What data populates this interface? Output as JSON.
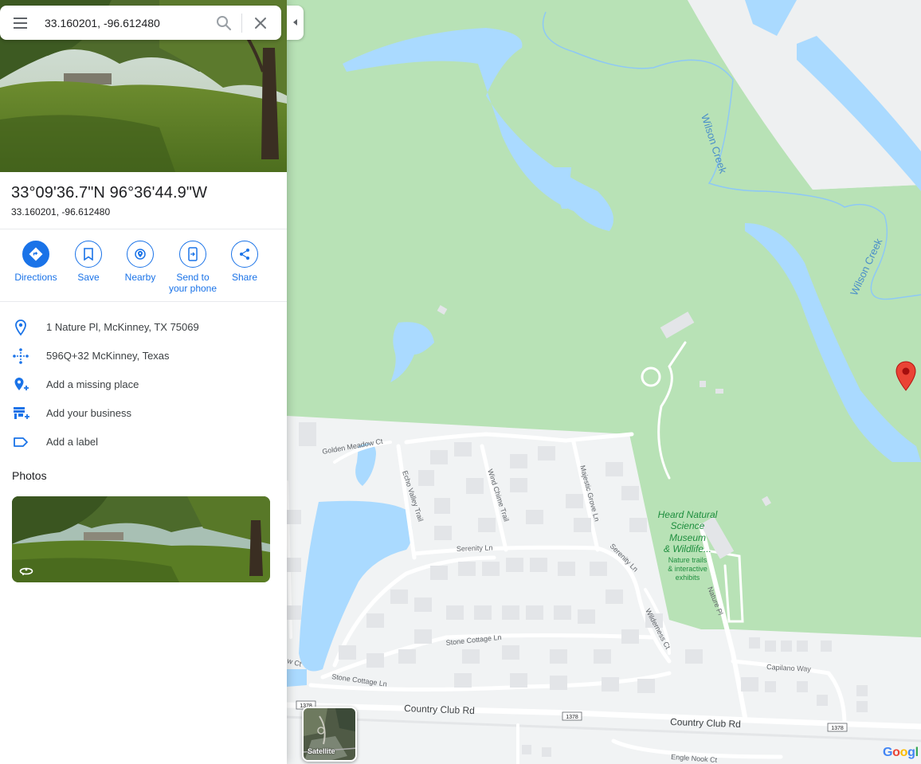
{
  "search": {
    "value": "33.160201, -96.612480"
  },
  "place": {
    "title": "33°09'36.7\"N 96°36'44.9\"W",
    "coords": "33.160201, -96.612480"
  },
  "actions": [
    {
      "label": "Directions",
      "icon": "directions-icon"
    },
    {
      "label": "Save",
      "icon": "bookmark-icon"
    },
    {
      "label": "Nearby",
      "icon": "nearby-icon"
    },
    {
      "label": "Send to your phone",
      "icon": "send-to-phone-icon"
    },
    {
      "label": "Share",
      "icon": "share-icon"
    }
  ],
  "details": [
    {
      "text": "1 Nature Pl, McKinney, TX 75069",
      "icon": "location-pin-icon"
    },
    {
      "text": "596Q+32 McKinney, Texas",
      "icon": "plus-code-icon"
    },
    {
      "text": "Add a missing place",
      "icon": "add-place-icon"
    },
    {
      "text": "Add your business",
      "icon": "add-business-icon"
    },
    {
      "text": "Add a label",
      "icon": "label-icon"
    }
  ],
  "photos": {
    "heading": "Photos"
  },
  "map": {
    "labels": {
      "wilson_creek": "Wilson Creek",
      "museum_name": "Heard Natural Science Museum & Wildlife...",
      "museum_l1": "Heard Natural",
      "museum_l2": "Science",
      "museum_l3": "Museum",
      "museum_l4": "& Wildlife...",
      "museum_sub1": "Nature trails",
      "museum_sub2": "& interactive",
      "museum_sub3": "exhibits",
      "golden_meadow": "Golden Meadow Ct",
      "echo_valley": "Echo Valley Trail",
      "wind_chime": "Wind Chime Trail",
      "majestic_grove": "Majestic Grove Ln",
      "serenity": "Serenity Ln",
      "wilderness": "Wilderness Ct",
      "nature_pl": "Nature Pl",
      "stone_cottage": "Stone Cottage Ln",
      "capilano": "Capilano Way",
      "country_club": "Country Club Rd",
      "engle_nook": "Engle Nook Ct",
      "route": "1378",
      "w_ct": "w Ct"
    },
    "satellite_label": "Satellite",
    "pin_color": "#ea4335",
    "park_color": "#b8e2b6",
    "water_color": "#aadaff"
  },
  "colors": {
    "accent": "#1a73e8"
  }
}
